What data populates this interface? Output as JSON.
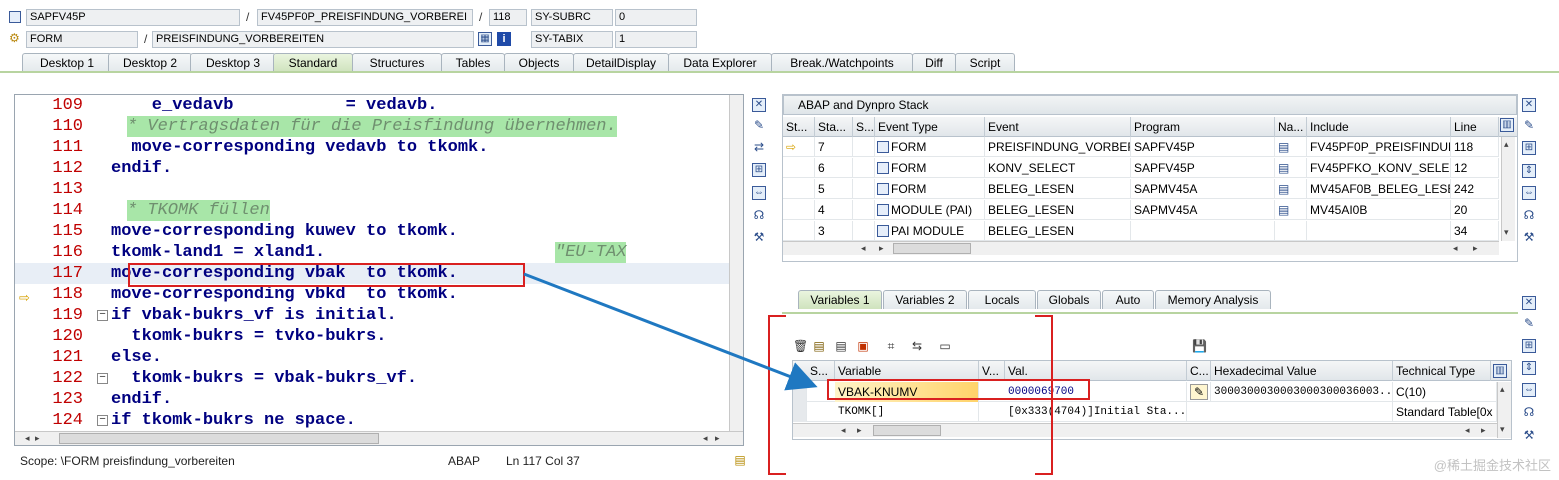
{
  "header": {
    "row1": {
      "program": "SAPFV45P",
      "include": "FV45PF0P_PREISFINDUNG_VORBEREI",
      "line": "118",
      "sysvar": "SY-SUBRC",
      "sysval": "0"
    },
    "row2": {
      "type": "FORM",
      "name": "PREISFINDUNG_VORBEREITEN",
      "sysvar": "SY-TABIX",
      "sysval": "1"
    },
    "sep": "/"
  },
  "tabs": [
    "Desktop 1",
    "Desktop 2",
    "Desktop 3",
    "Standard",
    "Structures",
    "Tables",
    "Objects",
    "DetailDisplay",
    "Data Explorer",
    "Break./Watchpoints",
    "Diff",
    "Script"
  ],
  "editor": {
    "lines": [
      {
        "num": "109",
        "text": "    e_vedavb           = vedavb."
      },
      {
        "num": "110",
        "text": "* Vertragsdaten für die Preisfindung übernehmen."
      },
      {
        "num": "111",
        "text": "  move-corresponding vedavb to tkomk."
      },
      {
        "num": "112",
        "text": "endif."
      },
      {
        "num": "113",
        "text": ""
      },
      {
        "num": "114",
        "text": "* TKOMK füllen"
      },
      {
        "num": "115",
        "text": "move-corresponding kuwev to tkomk."
      },
      {
        "num": "116",
        "text": "tkomk-land1 = xland1.",
        "comment": "\"EU-TAX"
      },
      {
        "num": "117",
        "text": "move-corresponding vbak  to tkomk."
      },
      {
        "num": "118",
        "text": "move-corresponding vbkd  to tkomk."
      },
      {
        "num": "119",
        "text": "if vbak-bukrs_vf is initial."
      },
      {
        "num": "120",
        "text": "  tkomk-bukrs = tvko-bukrs."
      },
      {
        "num": "121",
        "text": "else."
      },
      {
        "num": "122",
        "text": "  tkomk-bukrs = vbak-bukrs_vf."
      },
      {
        "num": "123",
        "text": "endif."
      },
      {
        "num": "124",
        "text": "if tkomk-bukrs ne space."
      }
    ]
  },
  "status": {
    "scope": "Scope: \\FORM preisfindung_vorbereiten",
    "lang": "ABAP",
    "position": "Ln 117 Col  37"
  },
  "stack": {
    "title": "ABAP and Dynpro Stack",
    "columns": [
      "St...",
      "Sta...",
      "S...",
      "Event Type",
      "Event",
      "Program",
      "Na...",
      "Include",
      "Line"
    ],
    "rows": [
      {
        "level": "7",
        "event_type": "FORM",
        "event": "PREISFINDUNG_VORBER...",
        "program": "SAPFV45P",
        "include": "FV45PF0P_PREISFINDUN...",
        "line": "118"
      },
      {
        "level": "6",
        "event_type": "FORM",
        "event": "KONV_SELECT",
        "program": "SAPFV45P",
        "include": "FV45PFKO_KONV_SELEC...",
        "line": "12"
      },
      {
        "level": "5",
        "event_type": "FORM",
        "event": "BELEG_LESEN",
        "program": "SAPMV45A",
        "include": "MV45AF0B_BELEG_LESEN",
        "line": "242"
      },
      {
        "level": "4",
        "event_type": "MODULE (PAI)",
        "event": "BELEG_LESEN",
        "program": "SAPMV45A",
        "include": "MV45AI0B",
        "line": "20"
      },
      {
        "level": "3",
        "event_type": "PAI MODULE",
        "event": "BELEG_LESEN",
        "program": "",
        "include": "",
        "line": "34"
      }
    ]
  },
  "var_tabs": [
    "Variables 1",
    "Variables 2",
    "Locals",
    "Globals",
    "Auto",
    "Memory Analysis"
  ],
  "variables": {
    "columns": [
      "S...",
      "Variable",
      "V...",
      "Val.",
      "C...",
      "Hexadecimal Value",
      "Technical Type"
    ],
    "rows": [
      {
        "name": "VBAK-KNUMV",
        "value": "0000069700",
        "hex": "3000300030003000300036003...",
        "type": "C(10)"
      },
      {
        "name": "TKOMK[]",
        "value": "[0x333(4704)]Initial Sta...",
        "hex": "",
        "type": "Standard Table[0x"
      }
    ]
  },
  "icons": {
    "titlebar_1": "program-icon",
    "titlebar_2": "form-icon",
    "current_marker": "arrow-right-icon"
  },
  "colors": {
    "accent_tab": "#cfe3bd",
    "keyword": "#000080",
    "linenum": "#c00000",
    "highlight": "#d92020",
    "arrow": "#1f78c1"
  },
  "watermark": "@稀土掘金技术社区"
}
